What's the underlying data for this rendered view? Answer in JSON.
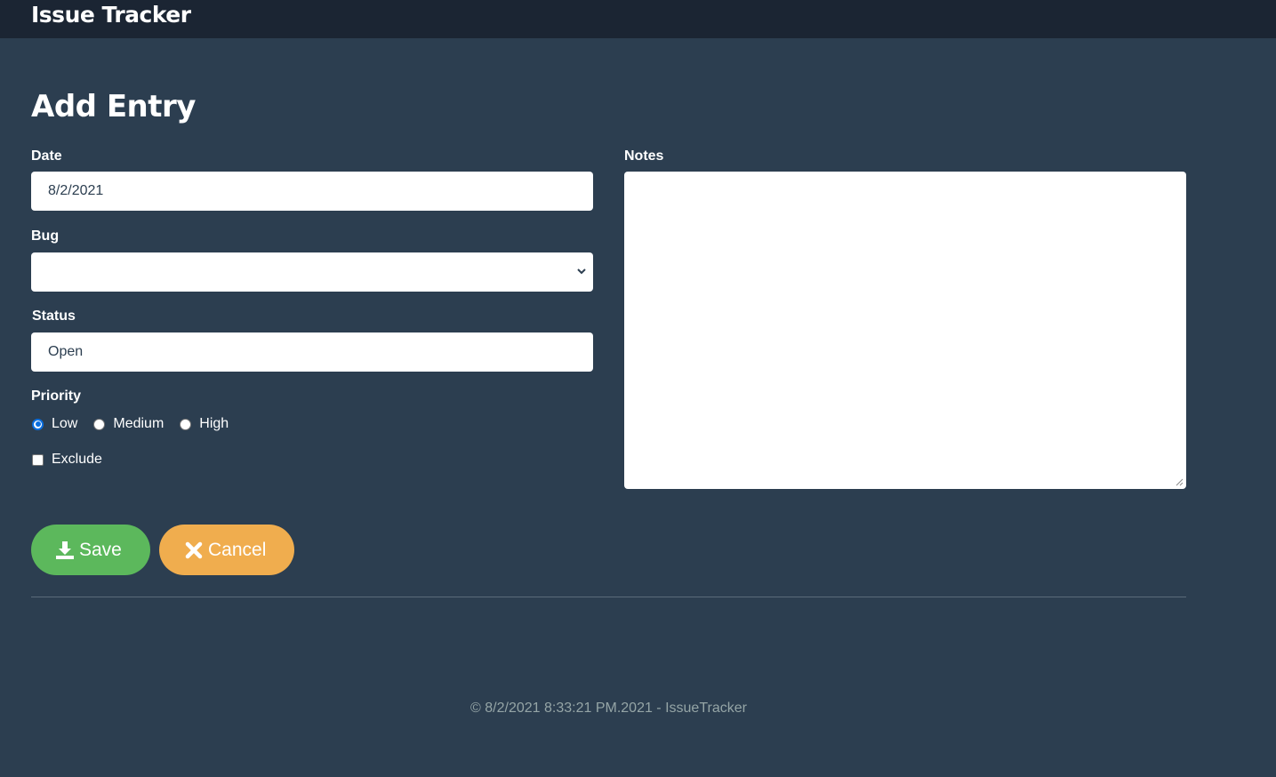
{
  "navbar": {
    "brand": "Issue Tracker"
  },
  "page": {
    "title": "Add Entry"
  },
  "form": {
    "date": {
      "label": "Date",
      "value": "8/2/2021"
    },
    "bug": {
      "label": "Bug",
      "selected_value": ""
    },
    "status": {
      "label": "Status",
      "value": "Open"
    },
    "priority": {
      "label": "Priority",
      "options": [
        "Low",
        "Medium",
        "High"
      ],
      "selected": "Low"
    },
    "exclude": {
      "label": "Exclude",
      "checked": false
    },
    "notes": {
      "label": "Notes",
      "value": ""
    },
    "buttons": {
      "save_label": "Save",
      "cancel_label": "Cancel"
    }
  },
  "footer": {
    "text": "© 8/2/2021 8:33:21 PM.2021 - IssueTracker"
  },
  "colors": {
    "background": "#2c3e50",
    "navbar": "#1b2533",
    "save": "#5cb85c",
    "cancel": "#f0ad4e",
    "radio_accent": "#0b6fe0",
    "footer_text": "#95a5a6"
  },
  "icons": {
    "save": "download-icon",
    "cancel": "close-icon",
    "select": "chevron-down-icon"
  }
}
